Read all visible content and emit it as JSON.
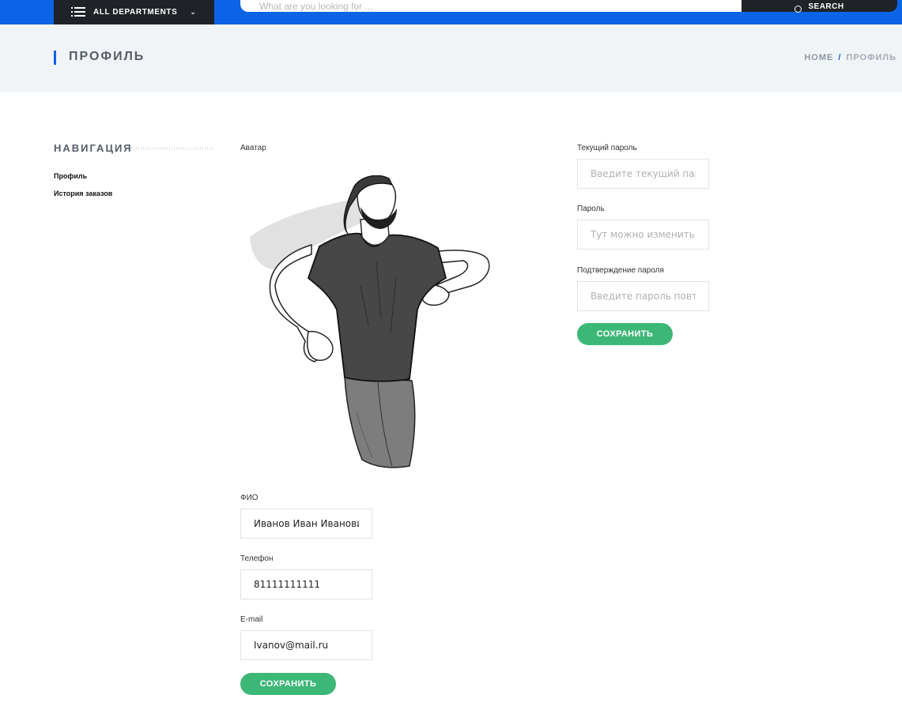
{
  "topbar": {
    "departments_label": "ALL DEPARTMENTS",
    "search_placeholder": "What are you looking for ...",
    "search_button": "SEARCH"
  },
  "page_header": {
    "title": "ПРОФИЛЬ",
    "breadcrumb_home": "HOME",
    "breadcrumb_sep": "/",
    "breadcrumb_current": "ПРОФИЛЬ"
  },
  "sidebar": {
    "heading": "НАВИГАЦИЯ",
    "items": [
      {
        "label": "Профиль"
      },
      {
        "label": "История заказов"
      }
    ]
  },
  "profile_form": {
    "avatar_label": "Аватар",
    "fio_label": "ФИО",
    "fio_value": "Иванов Иван Иванович",
    "phone_label": "Телефон",
    "phone_value": "81111111111",
    "email_label": "E-mail",
    "email_value": "Ivanov@mail.ru",
    "save_label": "СОХРАНИТЬ"
  },
  "password_form": {
    "current_label": "Текущий пароль",
    "current_placeholder": "Введите текущий пароль",
    "new_label": "Пароль",
    "new_placeholder": "Тут можно изменить пароль",
    "confirm_label": "Подтверждение пароля",
    "confirm_placeholder": "Введите пароль повторно",
    "save_label": "СОХРАНИТЬ"
  },
  "colors": {
    "accent": "#0b63e5",
    "dark": "#1f2227",
    "save_button": "#3cb776"
  }
}
